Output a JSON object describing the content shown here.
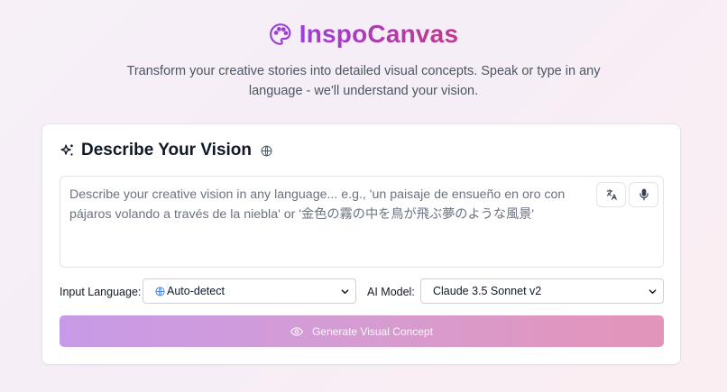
{
  "app": {
    "title": "InspoCanvas",
    "tagline": "Transform your creative stories into detailed visual concepts. Speak or type in any language - we'll understand your vision.",
    "logo_icon": "palette-icon",
    "brand_gradient": [
      "#9b3fd8",
      "#c0398a"
    ]
  },
  "card": {
    "title": "Describe Your Vision",
    "title_icon": "sparkles-icon",
    "title_badge_icon": "globe-icon"
  },
  "prompt": {
    "placeholder": "Describe your creative vision in any language... e.g., 'un paisaje de ensueño en oro con pájaros volando a través de la niebla' or '金色の霧の中を鳥が飛ぶ夢のような風景'",
    "value": "",
    "translate_icon": "translate-icon",
    "mic_icon": "microphone-icon"
  },
  "controls": {
    "input_language_label": "Input Language:",
    "input_language_value": "Auto-detect",
    "input_language_icon": "globe-icon",
    "ai_model_label": "AI Model:",
    "ai_model_value": "Claude 3.5 Sonnet v2"
  },
  "generate_button": {
    "label": "Generate Visual Concept",
    "icon": "eye-icon",
    "gradient": [
      "#c79ae8",
      "#e394b8"
    ]
  }
}
